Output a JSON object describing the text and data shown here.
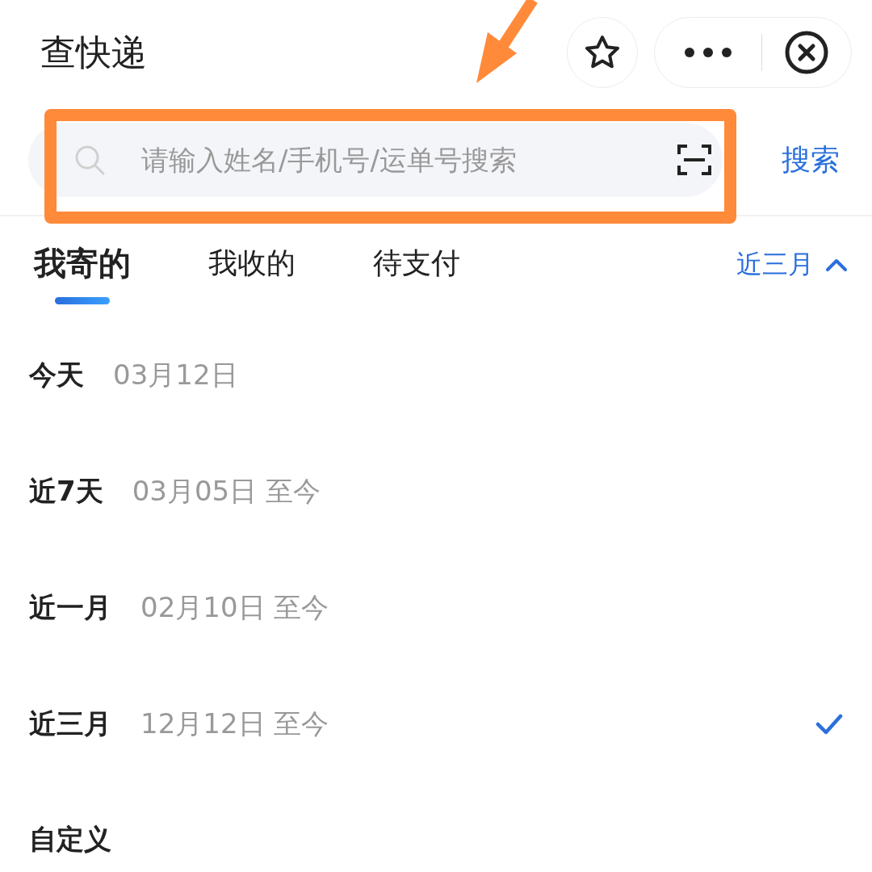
{
  "header": {
    "title": "查快递"
  },
  "search": {
    "placeholder": "请输入姓名/手机号/运单号搜索",
    "button": "搜索"
  },
  "annotation": {
    "kind": "highlight-arrow"
  },
  "tabs": [
    {
      "label": "我寄的",
      "selected": true
    },
    {
      "label": "我收的",
      "selected": false
    },
    {
      "label": "待支付",
      "selected": false
    }
  ],
  "range_filter": {
    "label": "近三月",
    "expanded": true
  },
  "ranges": [
    {
      "label": "今天",
      "date": "03月12日",
      "selected": false
    },
    {
      "label": "近7天",
      "date": "03月05日 至今",
      "selected": false
    },
    {
      "label": "近一月",
      "date": "02月10日 至今",
      "selected": false
    },
    {
      "label": "近三月",
      "date": "12月12日 至今",
      "selected": true
    },
    {
      "label": "自定义",
      "selected": false
    }
  ]
}
